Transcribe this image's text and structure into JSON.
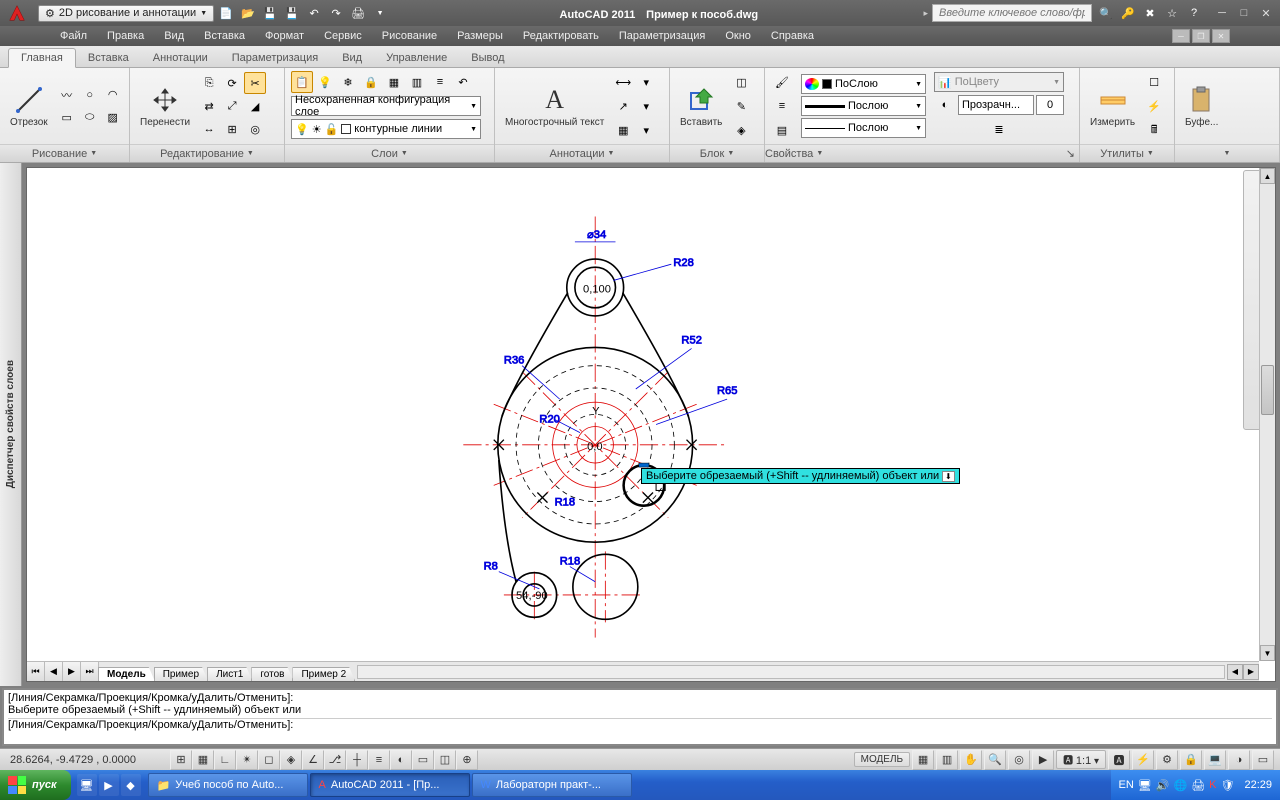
{
  "titlebar": {
    "workspace": "2D рисование и аннотации",
    "app": "AutoCAD 2011",
    "doc": "Пример к пособ.dwg",
    "search_placeholder": "Введите ключевое слово/фразу"
  },
  "menus": [
    "Файл",
    "Правка",
    "Вид",
    "Вставка",
    "Формат",
    "Сервис",
    "Рисование",
    "Размеры",
    "Редактировать",
    "Параметризация",
    "Окно",
    "Справка"
  ],
  "ribbon": {
    "tabs": [
      "Главная",
      "Вставка",
      "Аннотации",
      "Параметризация",
      "Вид",
      "Управление",
      "Вывод"
    ],
    "active_tab": 0,
    "panels": {
      "draw": {
        "big": "Отрезок",
        "title": "Рисование"
      },
      "edit": {
        "big": "Перенести",
        "title": "Редактирование"
      },
      "layers": {
        "title": "Слои",
        "combo_label": "Несохраненная конфигурация слое",
        "current": "контурные линии"
      },
      "anno": {
        "big": "Многострочный текст",
        "title": "Аннотации"
      },
      "block": {
        "big": "Вставить",
        "title": "Блок"
      },
      "props": {
        "title": "Свойства",
        "bylayer": "ПоСлою",
        "bylayer2": "Послою",
        "bylayer3": "Послою",
        "bycolor": "ПоЦвету",
        "trans_label": "Прозрачн...",
        "trans_val": "0"
      },
      "util": {
        "big": "Измерить",
        "title": "Утилиты"
      },
      "clip": {
        "big": "Буфе..."
      }
    }
  },
  "palette_title": "Диспетчер свойств слоев",
  "drawing": {
    "dims": {
      "d34": "⌀34",
      "r28": "R28",
      "r52": "R52",
      "r36": "R36",
      "r65": "R65",
      "r20": "R20",
      "r18a": "R18",
      "r18b": "R18",
      "r8": "R8"
    },
    "coord_top": "0,100",
    "coord_mid": "0,0",
    "coord_bot": "54,-90",
    "tooltip": "Выберите обрезаемый (+Shift -- удлиняемый) объект или"
  },
  "sheets": {
    "tabs": [
      "Модель",
      "Пример",
      "Лист1",
      "готов",
      "Пример 2"
    ],
    "active": 0
  },
  "cmd": {
    "line1": "[Линия/Секрамка/Проекция/Кромка/уДалить/Отменить]:",
    "line2": "Выберите обрезаемый (+Shift -- удлиняемый) объект или",
    "prompt": "[Линия/Секрамка/Проекция/Кромка/уДалить/Отменить]:"
  },
  "status": {
    "coords": "28.6264, -9.4729 , 0.0000",
    "model": "МОДЕЛЬ",
    "scale": "1:1"
  },
  "taskbar": {
    "start": "пуск",
    "tasks": [
      {
        "label": "Учеб пособ по Auto...",
        "icon": "folder"
      },
      {
        "label": "AutoCAD 2011 - [Пр...",
        "icon": "acad",
        "active": true
      },
      {
        "label": "Лабораторн практ-...",
        "icon": "word"
      }
    ],
    "lang": "EN",
    "clock": "22:29"
  }
}
